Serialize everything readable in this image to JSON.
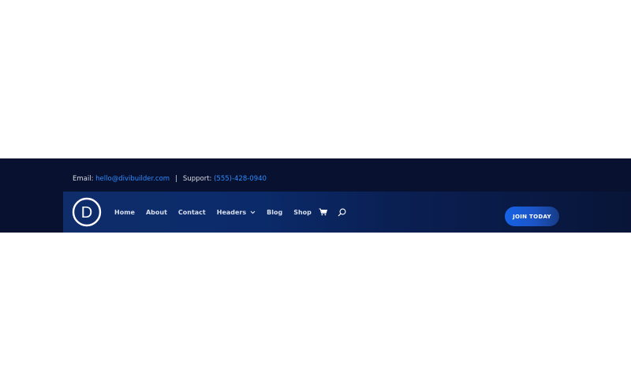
{
  "topbar": {
    "email_label": "Email:",
    "email_value": "hello@divibuilder.com",
    "separator": "|",
    "support_label": "Support:",
    "support_value": "(555)-428-0940"
  },
  "logo": {
    "letter": "D"
  },
  "nav": {
    "items": [
      {
        "label": "Home"
      },
      {
        "label": "About"
      },
      {
        "label": "Contact"
      },
      {
        "label": "Headers"
      },
      {
        "label": "Blog"
      },
      {
        "label": "Shop"
      }
    ],
    "icons": [
      "cart-icon",
      "search-icon"
    ]
  },
  "cta": {
    "label": "JOIN TODAY"
  },
  "colors": {
    "topbar_bg": "#08112f",
    "nav_gradient_start": "#0f2d6b",
    "nav_gradient_end": "#081538",
    "link_blue": "#2d8bff",
    "cta_blue": "#1563e6"
  }
}
